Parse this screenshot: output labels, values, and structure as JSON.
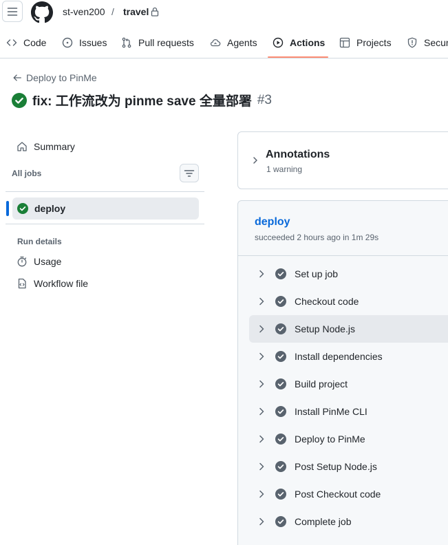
{
  "header": {
    "owner": "st-ven200",
    "separator": "/",
    "repo": "travel",
    "icons": {
      "menu": "hamburger-icon",
      "logo": "github-mark-icon",
      "visibility": "lock-icon"
    }
  },
  "repo_nav": {
    "tabs": [
      {
        "label": "Code",
        "icon": "code-icon"
      },
      {
        "label": "Issues",
        "icon": "issue-opened-icon"
      },
      {
        "label": "Pull requests",
        "icon": "git-pull-request-icon"
      },
      {
        "label": "Agents",
        "icon": "agent-cloud-icon"
      },
      {
        "label": "Actions",
        "icon": "play-icon",
        "active": true
      },
      {
        "label": "Projects",
        "icon": "table-icon"
      },
      {
        "label": "Secur",
        "icon": "shield-icon"
      }
    ],
    "active_color": "#fd8c73"
  },
  "run": {
    "back_label": "Deploy to PinMe",
    "title": "fix: 工作流改为 pinme save 全量部署",
    "number": "#3",
    "status": "success",
    "success_color": "#1a7f37"
  },
  "sidebar": {
    "summary_label": "Summary",
    "all_jobs_label": "All jobs",
    "jobs": [
      {
        "label": "deploy",
        "status": "success"
      }
    ],
    "run_details_label": "Run details",
    "detail_links": [
      {
        "label": "Usage",
        "icon": "stopwatch-icon"
      },
      {
        "label": "Workflow file",
        "icon": "file-code-icon"
      }
    ]
  },
  "annotations": {
    "title": "Annotations",
    "subtitle": "1 warning"
  },
  "job": {
    "name": "deploy",
    "meta": "succeeded 2 hours ago in 1m 29s",
    "link_color": "#0969da",
    "steps": [
      {
        "label": "Set up job"
      },
      {
        "label": "Checkout code"
      },
      {
        "label": "Setup Node.js",
        "highlighted": true
      },
      {
        "label": "Install dependencies"
      },
      {
        "label": "Build project"
      },
      {
        "label": "Install PinMe CLI"
      },
      {
        "label": "Deploy to PinMe"
      },
      {
        "label": "Post Setup Node.js"
      },
      {
        "label": "Post Checkout code"
      },
      {
        "label": "Complete job"
      }
    ]
  }
}
